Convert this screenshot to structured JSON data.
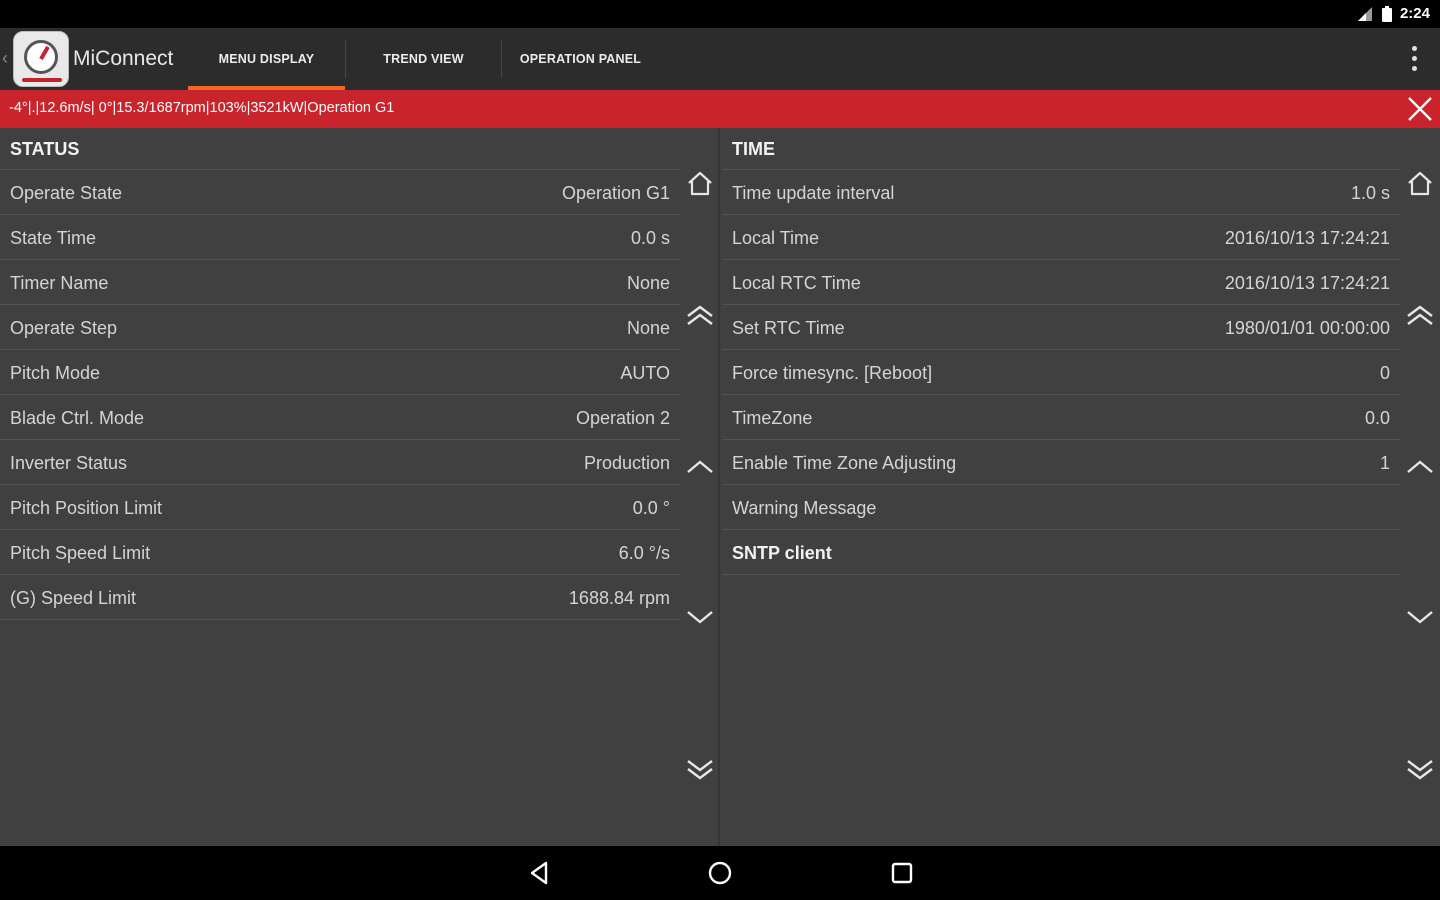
{
  "statusbar": {
    "time": "2:24"
  },
  "app": {
    "title": "MiConnect"
  },
  "tabs": [
    {
      "label": "MENU DISPLAY",
      "active": true
    },
    {
      "label": "TREND VIEW",
      "active": false
    },
    {
      "label": "OPERATION PANEL",
      "active": false
    }
  ],
  "alert": {
    "text": "-4°|.|12.6m/s| 0°|15.3/1687rpm|103%|3521kW|Operation G1"
  },
  "status_panel": {
    "header": "STATUS",
    "rows": [
      {
        "label": "Operate State",
        "value": "Operation G1"
      },
      {
        "label": "State Time",
        "value": "0.0 s"
      },
      {
        "label": "Timer Name",
        "value": "None"
      },
      {
        "label": "Operate Step",
        "value": "None"
      },
      {
        "label": "Pitch Mode",
        "value": "AUTO"
      },
      {
        "label": "Blade Ctrl. Mode",
        "value": "Operation 2"
      },
      {
        "label": "Inverter Status",
        "value": "Production"
      },
      {
        "label": "Pitch Position Limit",
        "value": "0.0 °"
      },
      {
        "label": "Pitch Speed Limit",
        "value": "6.0 °/s"
      },
      {
        "label": "(G) Speed Limit",
        "value": "1688.84 rpm"
      }
    ]
  },
  "time_panel": {
    "header": "TIME",
    "rows": [
      {
        "label": "Time update interval",
        "value": "1.0 s"
      },
      {
        "label": "Local Time",
        "value": "2016/10/13 17:24:21"
      },
      {
        "label": "Local RTC Time",
        "value": "2016/10/13 17:24:21"
      },
      {
        "label": "Set RTC Time",
        "value": "1980/01/01 00:00:00"
      },
      {
        "label": "Force timesync. [Reboot]",
        "value": "0"
      },
      {
        "label": "TimeZone",
        "value": "0.0"
      },
      {
        "label": "Enable Time Zone Adjusting",
        "value": "1"
      },
      {
        "label": "Warning Message",
        "value": ""
      },
      {
        "label": "SNTP client",
        "value": ""
      }
    ]
  },
  "icons": {
    "home": "home-icon",
    "page_up": "double-chevron-up-icon",
    "up": "chevron-up-icon",
    "down": "chevron-down-icon",
    "page_down": "double-chevron-down-icon",
    "close": "close-icon",
    "overflow": "more-vert-icon"
  },
  "colors": {
    "accent": "#f26522",
    "alert": "#c9242c",
    "background": "#404040"
  }
}
